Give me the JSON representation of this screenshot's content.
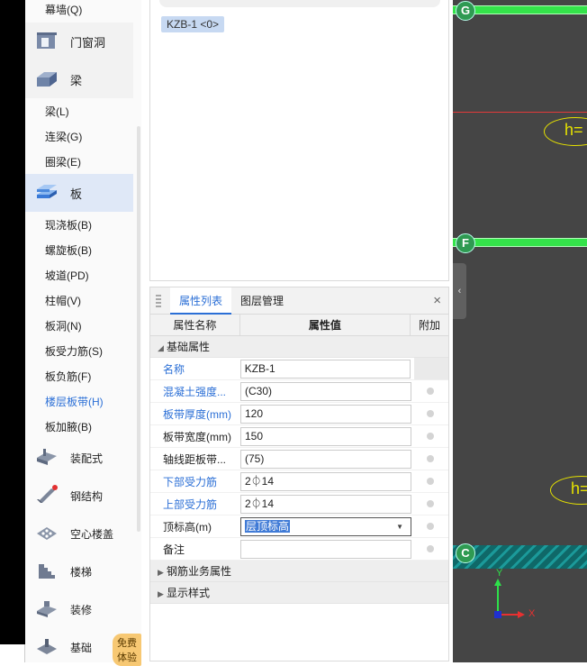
{
  "sidebar": {
    "top_item": "幕墙(Q)",
    "cats": [
      {
        "label": "门窗洞",
        "icon": "door-window-icon"
      },
      {
        "label": "梁",
        "icon": "beam-icon"
      },
      {
        "label": "板",
        "icon": "slab-icon"
      }
    ],
    "beam_items": [
      "梁(L)",
      "连梁(G)",
      "圈梁(E)"
    ],
    "slab_items": [
      "现浇板(B)",
      "螺旋板(B)",
      "坡道(PD)",
      "柱帽(V)",
      "板洞(N)",
      "板受力筋(S)",
      "板负筋(F)",
      "楼层板带(H)",
      "板加腋(B)"
    ],
    "lower_cats": [
      {
        "label": "装配式",
        "icon": "prefab-icon"
      },
      {
        "label": "钢结构",
        "icon": "steel-structure-icon"
      },
      {
        "label": "空心楼盖",
        "icon": "hollow-floor-icon"
      },
      {
        "label": "楼梯",
        "icon": "stairs-icon"
      },
      {
        "label": "装修",
        "icon": "decoration-icon"
      },
      {
        "label": "基础",
        "icon": "foundation-icon"
      }
    ],
    "trial_badge": "免费体验"
  },
  "component_tag": "KZB-1 <0>",
  "prop_panel": {
    "tabs": [
      "属性列表",
      "图层管理"
    ],
    "close": "×",
    "headers": [
      "属性名称",
      "属性值",
      "附加"
    ],
    "groups": [
      "基础属性",
      "钢筋业务属性",
      "显示样式"
    ],
    "rows": [
      {
        "name": "名称",
        "value": "KZB-1",
        "blue": true
      },
      {
        "name": "混凝土强度...",
        "value": "(C30)",
        "blue": true
      },
      {
        "name": "板带厚度(mm)",
        "value": "120",
        "blue": true
      },
      {
        "name": "板带宽度(mm)",
        "value": "150",
        "blue": false
      },
      {
        "name": "轴线距板带...",
        "value": "(75)",
        "blue": false
      },
      {
        "name": "下部受力筋",
        "value": "2⏀14",
        "blue": true
      },
      {
        "name": "上部受力筋",
        "value": "2⏀14",
        "blue": true
      },
      {
        "name": "顶标高(m)",
        "value": "层顶标高",
        "blue": false
      },
      {
        "name": "备注",
        "value": "",
        "blue": false
      }
    ]
  },
  "drawing": {
    "axes": [
      "G",
      "F",
      "C"
    ],
    "height_label": "h=",
    "axis_x": "X",
    "axis_y": "Y",
    "colors": {
      "axis_band": "#34e34a",
      "background": "#454545",
      "text": "#e6e200"
    }
  }
}
